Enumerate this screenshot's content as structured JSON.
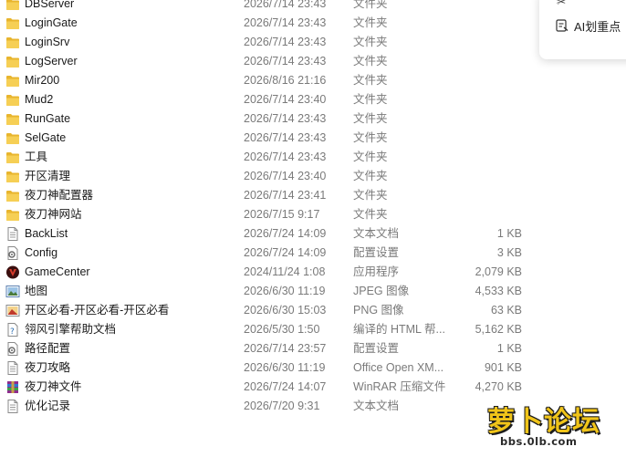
{
  "files": [
    {
      "name": "DBServer",
      "date": "2026/7/14 23:43",
      "type": "文件夹",
      "size": "",
      "icon": "folder-icon"
    },
    {
      "name": "LoginGate",
      "date": "2026/7/14 23:43",
      "type": "文件夹",
      "size": "",
      "icon": "folder-icon"
    },
    {
      "name": "LoginSrv",
      "date": "2026/7/14 23:43",
      "type": "文件夹",
      "size": "",
      "icon": "folder-icon"
    },
    {
      "name": "LogServer",
      "date": "2026/7/14 23:43",
      "type": "文件夹",
      "size": "",
      "icon": "folder-icon"
    },
    {
      "name": "Mir200",
      "date": "2026/8/16 21:16",
      "type": "文件夹",
      "size": "",
      "icon": "folder-icon"
    },
    {
      "name": "Mud2",
      "date": "2026/7/14 23:40",
      "type": "文件夹",
      "size": "",
      "icon": "folder-icon"
    },
    {
      "name": "RunGate",
      "date": "2026/7/14 23:43",
      "type": "文件夹",
      "size": "",
      "icon": "folder-icon"
    },
    {
      "name": "SelGate",
      "date": "2026/7/14 23:43",
      "type": "文件夹",
      "size": "",
      "icon": "folder-icon"
    },
    {
      "name": "工具",
      "date": "2026/7/14 23:43",
      "type": "文件夹",
      "size": "",
      "icon": "folder-icon"
    },
    {
      "name": "开区清理",
      "date": "2026/7/14 23:40",
      "type": "文件夹",
      "size": "",
      "icon": "folder-icon"
    },
    {
      "name": "夜刀神配置器",
      "date": "2026/7/14 23:41",
      "type": "文件夹",
      "size": "",
      "icon": "folder-icon"
    },
    {
      "name": "夜刀神网站",
      "date": "2026/7/15 9:17",
      "type": "文件夹",
      "size": "",
      "icon": "folder-icon"
    },
    {
      "name": "BackList",
      "date": "2026/7/24 14:09",
      "type": "文本文档",
      "size": "1 KB",
      "icon": "text-file-icon"
    },
    {
      "name": "Config",
      "date": "2026/7/24 14:09",
      "type": "配置设置",
      "size": "3 KB",
      "icon": "config-file-icon"
    },
    {
      "name": "GameCenter",
      "date": "2024/11/24 1:08",
      "type": "应用程序",
      "size": "2,079 KB",
      "icon": "app-icon"
    },
    {
      "name": "地图",
      "date": "2026/6/30 11:19",
      "type": "JPEG 图像",
      "size": "4,533 KB",
      "icon": "image-icon"
    },
    {
      "name": "开区必看-开区必看-开区必看",
      "date": "2026/6/30 15:03",
      "type": "PNG 图像",
      "size": "63 KB",
      "icon": "png-image-icon"
    },
    {
      "name": "翎风引擎帮助文档",
      "date": "2026/5/30 1:50",
      "type": "编译的 HTML 帮...",
      "size": "5,162 KB",
      "icon": "help-file-icon"
    },
    {
      "name": "路径配置",
      "date": "2026/7/14 23:57",
      "type": "配置设置",
      "size": "1 KB",
      "icon": "config-file-icon"
    },
    {
      "name": "夜刀攻略",
      "date": "2026/6/30 11:19",
      "type": "Office Open XM...",
      "size": "901 KB",
      "icon": "text-file-icon"
    },
    {
      "name": "夜刀神文件",
      "date": "2026/7/24 14:07",
      "type": "WinRAR 压缩文件",
      "size": "4,270 KB",
      "icon": "archive-icon"
    },
    {
      "name": "优化记录",
      "date": "2026/7/20 9:31",
      "type": "文本文档",
      "size": "",
      "icon": "text-file-icon"
    }
  ],
  "side_panel": {
    "ai_label": "AI划重点",
    "ai_icon": "ai-highlight-icon",
    "top_icon": "scissors-icon"
  },
  "watermark": {
    "title": "萝卜论坛",
    "url": "bbs.0lb.com"
  },
  "colors": {
    "folder": "#f2c440",
    "secondary_text": "#7a7a7a",
    "watermark_yellow": "#f0c419"
  }
}
